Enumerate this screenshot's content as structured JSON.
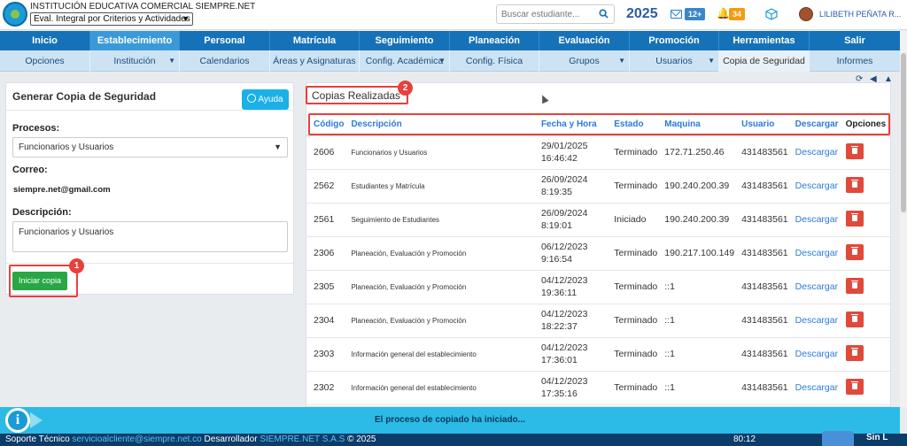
{
  "header": {
    "institution": "INSTITUCIÓN EDUCATIVA COMERCIAL SIEMPRE.NET",
    "evaluation_mode": "Eval. Integral por Criterios y Actividades",
    "search_placeholder": "Buscar estudiante...",
    "year": "2025",
    "messages_count": "12+",
    "notifications_count": "34",
    "user_name": "LILIBETH PEÑATA R..."
  },
  "nav_main": [
    {
      "label": "Inicio"
    },
    {
      "label": "Establecimiento"
    },
    {
      "label": "Personal"
    },
    {
      "label": "Matrícula"
    },
    {
      "label": "Seguimiento"
    },
    {
      "label": "Planeación"
    },
    {
      "label": "Evaluación"
    },
    {
      "label": "Promoción"
    },
    {
      "label": "Herramientas"
    },
    {
      "label": "Salir"
    }
  ],
  "nav_sub": [
    {
      "label": "Opciones"
    },
    {
      "label": "Institución"
    },
    {
      "label": "Calendarios"
    },
    {
      "label": "Áreas y Asignaturas"
    },
    {
      "label": "Config. Académica"
    },
    {
      "label": "Config. Física"
    },
    {
      "label": "Grupos"
    },
    {
      "label": "Usuarios"
    },
    {
      "label": "Copia de Seguridad"
    },
    {
      "label": "Informes"
    }
  ],
  "left_panel": {
    "title": "Generar Copia de Seguridad",
    "help_label": "Ayuda",
    "procesos_label": "Procesos:",
    "procesos_value": "Funcionarios y Usuarios",
    "correo_label": "Correo:",
    "correo_value": "siempre.net@gmail.com",
    "descripcion_label": "Descripción:",
    "descripcion_value": "Funcionarios y Usuarios",
    "start_button": "Iniciar copia",
    "callout_number": "1"
  },
  "right_panel": {
    "title": "Copias Realizadas",
    "callout_number": "2",
    "columns": {
      "codigo": "Código",
      "descripcion": "Descripción",
      "fecha": "Fecha y Hora",
      "estado": "Estado",
      "maquina": "Maquina",
      "usuario": "Usuario",
      "descargar": "Descargar",
      "opciones": "Opciones"
    },
    "rows": [
      {
        "codigo": "2606",
        "descripcion": "Funcionarios y Usuarios",
        "fecha": "29/01/2025",
        "hora": "16:46:42",
        "estado": "Terminado",
        "maquina": "172.71.250.46",
        "usuario": "431483561",
        "descargar": "Descargar"
      },
      {
        "codigo": "2562",
        "descripcion": "Estudiantes y Matrícula",
        "fecha": "26/09/2024",
        "hora": "8:19:35",
        "estado": "Terminado",
        "maquina": "190.240.200.39",
        "usuario": "431483561",
        "descargar": "Descargar"
      },
      {
        "codigo": "2561",
        "descripcion": "Seguimiento de Estudiantes",
        "fecha": "26/09/2024",
        "hora": "8:19:01",
        "estado": "Iniciado",
        "maquina": "190.240.200.39",
        "usuario": "431483561",
        "descargar": "Descargar"
      },
      {
        "codigo": "2306",
        "descripcion": "Planeación, Evaluación y Promoción",
        "fecha": "06/12/2023",
        "hora": "9:16:54",
        "estado": "Terminado",
        "maquina": "190.217.100.149",
        "usuario": "431483561",
        "descargar": "Descargar"
      },
      {
        "codigo": "2305",
        "descripcion": "Planeación, Evaluación y Promoción",
        "fecha": "04/12/2023",
        "hora": "19:36:11",
        "estado": "Terminado",
        "maquina": "::1",
        "usuario": "431483561",
        "descargar": "Descargar"
      },
      {
        "codigo": "2304",
        "descripcion": "Planeación, Evaluación y Promoción",
        "fecha": "04/12/2023",
        "hora": "18:22:37",
        "estado": "Terminado",
        "maquina": "::1",
        "usuario": "431483561",
        "descargar": "Descargar"
      },
      {
        "codigo": "2303",
        "descripcion": "Información general del establecimiento",
        "fecha": "04/12/2023",
        "hora": "17:36:01",
        "estado": "Terminado",
        "maquina": "::1",
        "usuario": "431483561",
        "descargar": "Descargar"
      },
      {
        "codigo": "2302",
        "descripcion": "Información general del establecimiento",
        "fecha": "04/12/2023",
        "hora": "17:35:16",
        "estado": "Terminado",
        "maquina": "::1",
        "usuario": "431483561",
        "descargar": "Descargar"
      }
    ]
  },
  "notification": {
    "icon_letter": "i",
    "message": "El proceso de copiado ha iniciado..."
  },
  "footer": {
    "support_label": "Soporte Técnico",
    "support_email": "servicioalcliente@siempre.net.co",
    "developer_label": "Desarrollador",
    "developer_name": "SIEMPRE.NET S.A.S",
    "copyright": "© 2025",
    "time": "80:12",
    "brand": "Sin L"
  },
  "colors": {
    "nav_primary": "#1672b8",
    "nav_active": "#3a9ad9",
    "nav_sub": "#cde3f3",
    "accent_link": "#2b7bd8",
    "callout_red": "#e8403b",
    "success_green": "#28a745",
    "danger_red": "#e04a3b",
    "notify_bar": "#2bbbe6",
    "footer_bg": "#0b3c6a"
  }
}
